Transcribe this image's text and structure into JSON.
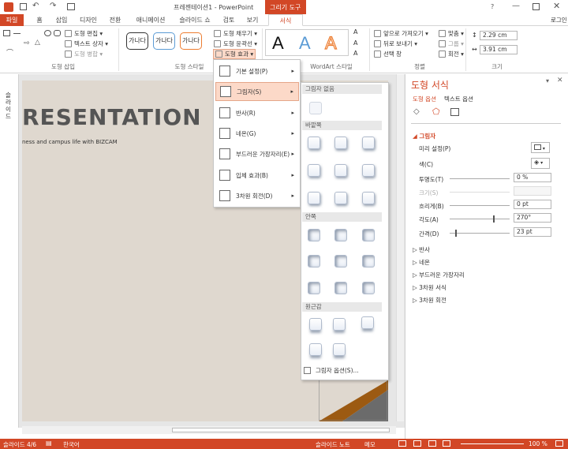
{
  "window": {
    "title": "프레젠테이션1 - PowerPoint",
    "context_tab_group": "그리기 도구",
    "help": "?",
    "user": "로그인"
  },
  "tabs": [
    "파일",
    "홈",
    "삽입",
    "디자인",
    "전환",
    "애니메이션",
    "슬라이드 쇼",
    "검토",
    "보기",
    "서식"
  ],
  "ribbon": {
    "insert_shapes": {
      "edit_shape": "도형 편집 ▾",
      "text_box": "텍스트 상자 ▾",
      "merge": "도형 병합 ▾",
      "label": "도형 삽입"
    },
    "styles": {
      "samples": [
        "가나다",
        "가나다",
        "가나다"
      ],
      "fill": "도형 채우기 ▾",
      "outline": "도형 윤곽선 ▾",
      "effects": "도형 효과 ▾",
      "label": "도형 스타일"
    },
    "wordart": {
      "letters": [
        "A",
        "A",
        "A"
      ],
      "label": "WordArt 스타일"
    },
    "arrange": {
      "bring_forward": "앞으로 가져오기 ▾",
      "send_backward": "뒤로 보내기 ▾",
      "selection": "선택 창",
      "align": "맞춤 ▾",
      "group": "그룹 ▾",
      "rotate": "회전 ▾",
      "label": "정렬"
    },
    "size": {
      "height": "2.29 cm",
      "width": "3.91 cm",
      "label": "크기"
    }
  },
  "left_panel_label": "슬라이드",
  "slide": {
    "title": "RESENTATION",
    "subtitle": "ness and campus life with BIZCAM"
  },
  "effects_menu": [
    "기본 설정(P)",
    "그림자(S)",
    "반사(R)",
    "네온(G)",
    "부드러운 가장자리(E)",
    "입체 효과(B)",
    "3차원 회전(D)"
  ],
  "shadow_gallery": {
    "none": "그림자 없음",
    "outer": "바깥쪽",
    "inner": "안쪽",
    "perspective": "원근감",
    "options": "그림자 옵션(S)..."
  },
  "format_pane": {
    "title": "도형 서식",
    "tab_shape": "도형 옵션",
    "tab_text": "텍스트 옵션",
    "section": "그림자",
    "preset": "미리 설정(P)",
    "color": "색(C)",
    "transparency": {
      "label": "투명도(T)",
      "value": "0 %"
    },
    "size": {
      "label": "크기(S)",
      "value": ""
    },
    "blur": {
      "label": "흐리게(B)",
      "value": "0 pt"
    },
    "angle": {
      "label": "각도(A)",
      "value": "270°"
    },
    "distance": {
      "label": "간격(D)",
      "value": "23 pt"
    },
    "collapsed": [
      "반사",
      "네온",
      "부드러운 가장자리",
      "3차원 서식",
      "3차원 회전"
    ]
  },
  "status": {
    "slide": "슬라이드 4/6",
    "language": "한국어",
    "notes": "슬라이드 노트",
    "memo": "메모",
    "zoom": "100 %"
  }
}
